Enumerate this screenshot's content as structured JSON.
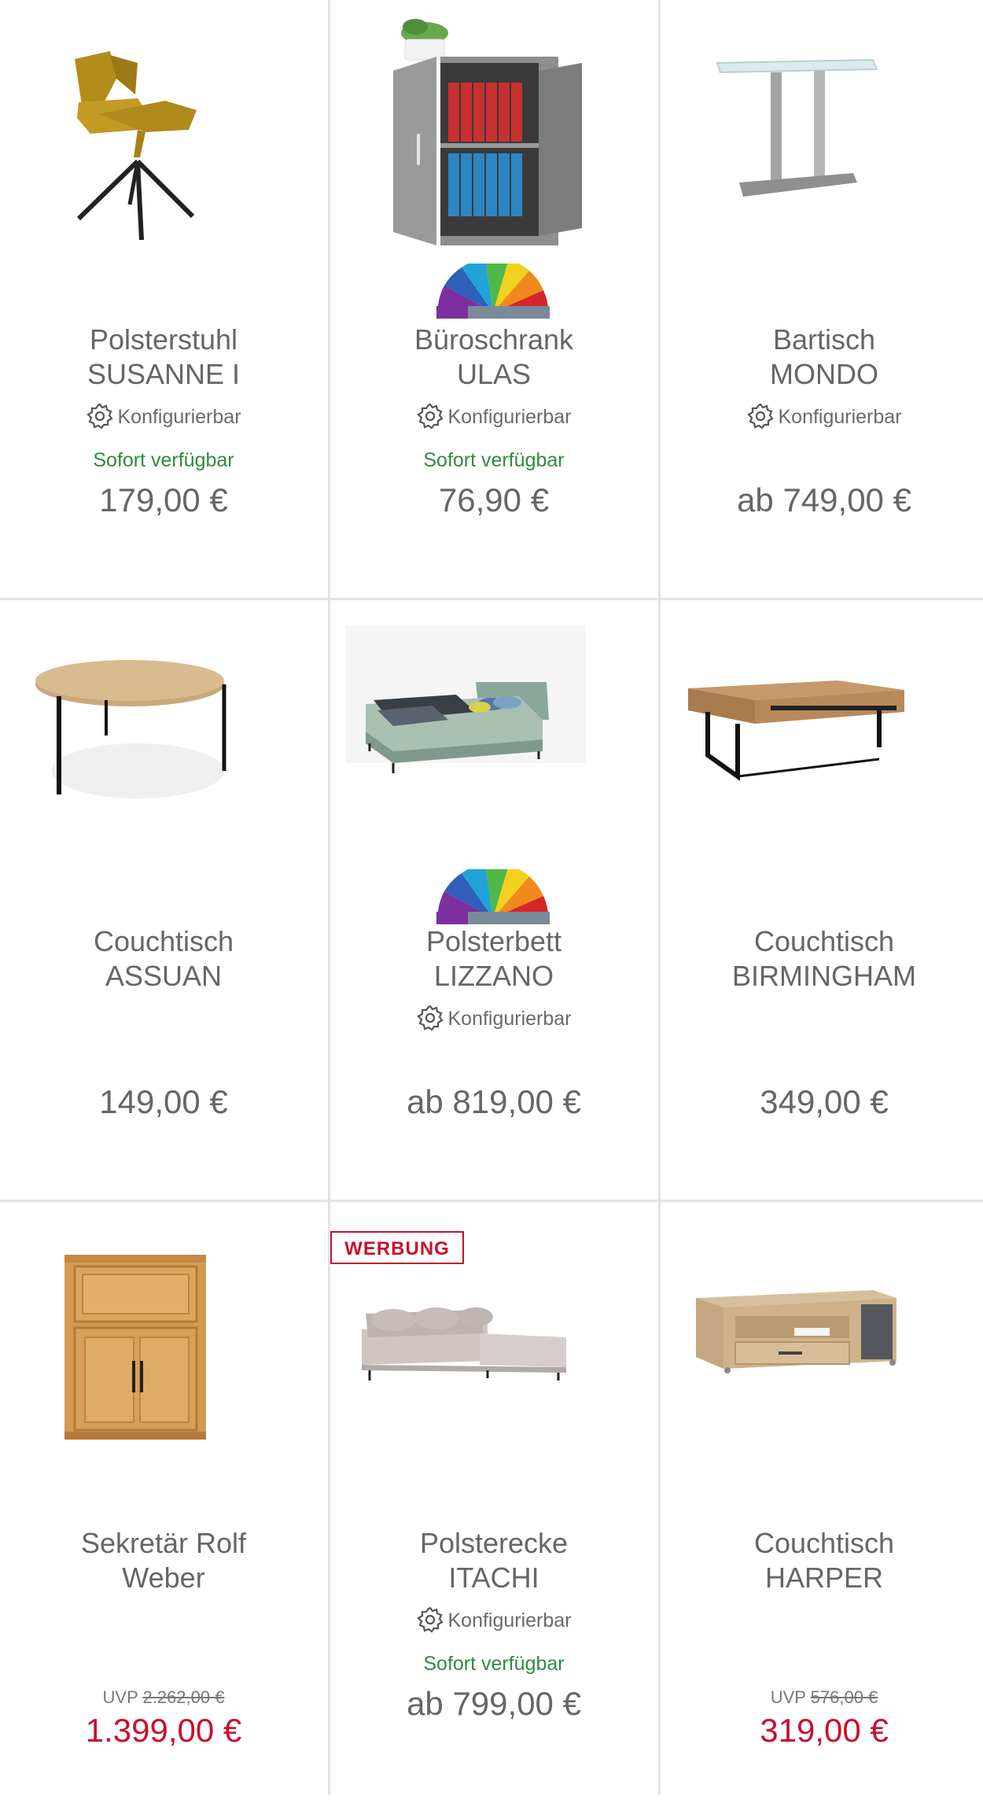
{
  "products": [
    {
      "line1": "Polsterstuhl",
      "line2": "SUSANNE I",
      "config": "Konfigurierbar",
      "avail": "Sofort verfügbar",
      "price": "179,00 €"
    },
    {
      "line1": "Büroschrank",
      "line2": "ULAS",
      "config": "Konfigurierbar",
      "avail": "Sofort verfügbar",
      "price": "76,90 €"
    },
    {
      "line1": "Bartisch",
      "line2": "MONDO",
      "config": "Konfigurierbar",
      "price": "ab 749,00 €"
    },
    {
      "line1": "Couchtisch",
      "line2": "ASSUAN",
      "price": "149,00 €"
    },
    {
      "line1": "Polsterbett",
      "line2": "LIZZANO",
      "config": "Konfigurierbar",
      "price": "ab 819,00 €"
    },
    {
      "line1": "Couchtisch",
      "line2": "BIRMINGHAM",
      "price": "349,00 €"
    },
    {
      "line1": "Sekretär Rolf",
      "line2": "Weber",
      "uvp_label": "UVP",
      "uvp_old": "2.262,00 €",
      "price": "1.399,00 €"
    },
    {
      "line1": "Polsterecke",
      "line2": "ITACHI",
      "config": "Konfigurierbar",
      "avail": "Sofort verfügbar",
      "price": "ab 799,00 €",
      "badge": "WERBUNG"
    },
    {
      "line1": "Couchtisch",
      "line2": "HARPER",
      "uvp_label": "UVP",
      "uvp_old": "576,00 €",
      "price": "319,00 €"
    }
  ],
  "colors": {
    "text": "#666666",
    "available": "#2e8b3e",
    "sale": "#c8102e",
    "divider": "#e3e3e3"
  },
  "icons": {
    "config": "gear-icon",
    "brand": "color-fan-icon"
  }
}
